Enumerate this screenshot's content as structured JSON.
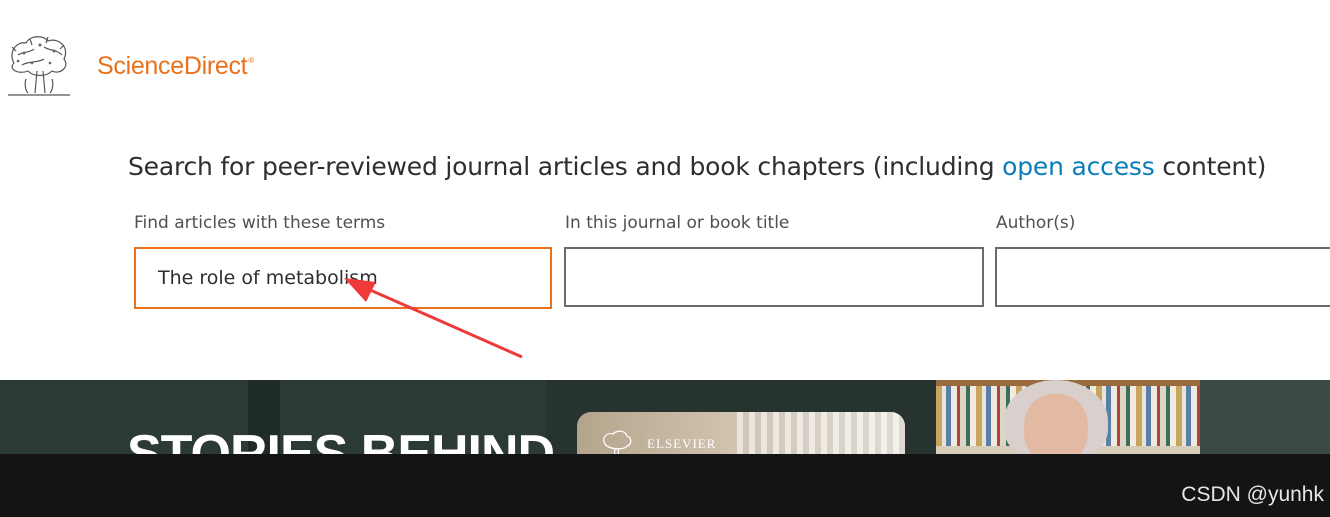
{
  "header": {
    "logo_icon": "elsevier-tree-logo-icon",
    "brand_name": "ScienceDirect",
    "brand_mark": "®"
  },
  "search": {
    "headline_prefix": "Search for peer-reviewed journal articles and book chapters (including",
    "headline_link": "open access",
    "headline_suffix": "content)",
    "fields": {
      "terms": {
        "label": "Find articles with these terms",
        "value": "The role of metabolism"
      },
      "journal": {
        "label": "In this journal or book title",
        "value": ""
      },
      "author": {
        "label": "Author(s)",
        "value": ""
      }
    }
  },
  "banner": {
    "title": "STORIES BEHIND",
    "card_text": "ELSEVIER",
    "card_icon": "elsevier-tree-logo-icon"
  },
  "annotation": {
    "arrow_icon": "red-arrow-icon",
    "color": "#ee3a3a"
  },
  "watermark": "CSDN @yunhk",
  "colors": {
    "brand": "#e9711c",
    "link": "#0c7dbb",
    "banner": "#2b3a35",
    "footer": "#141414"
  }
}
